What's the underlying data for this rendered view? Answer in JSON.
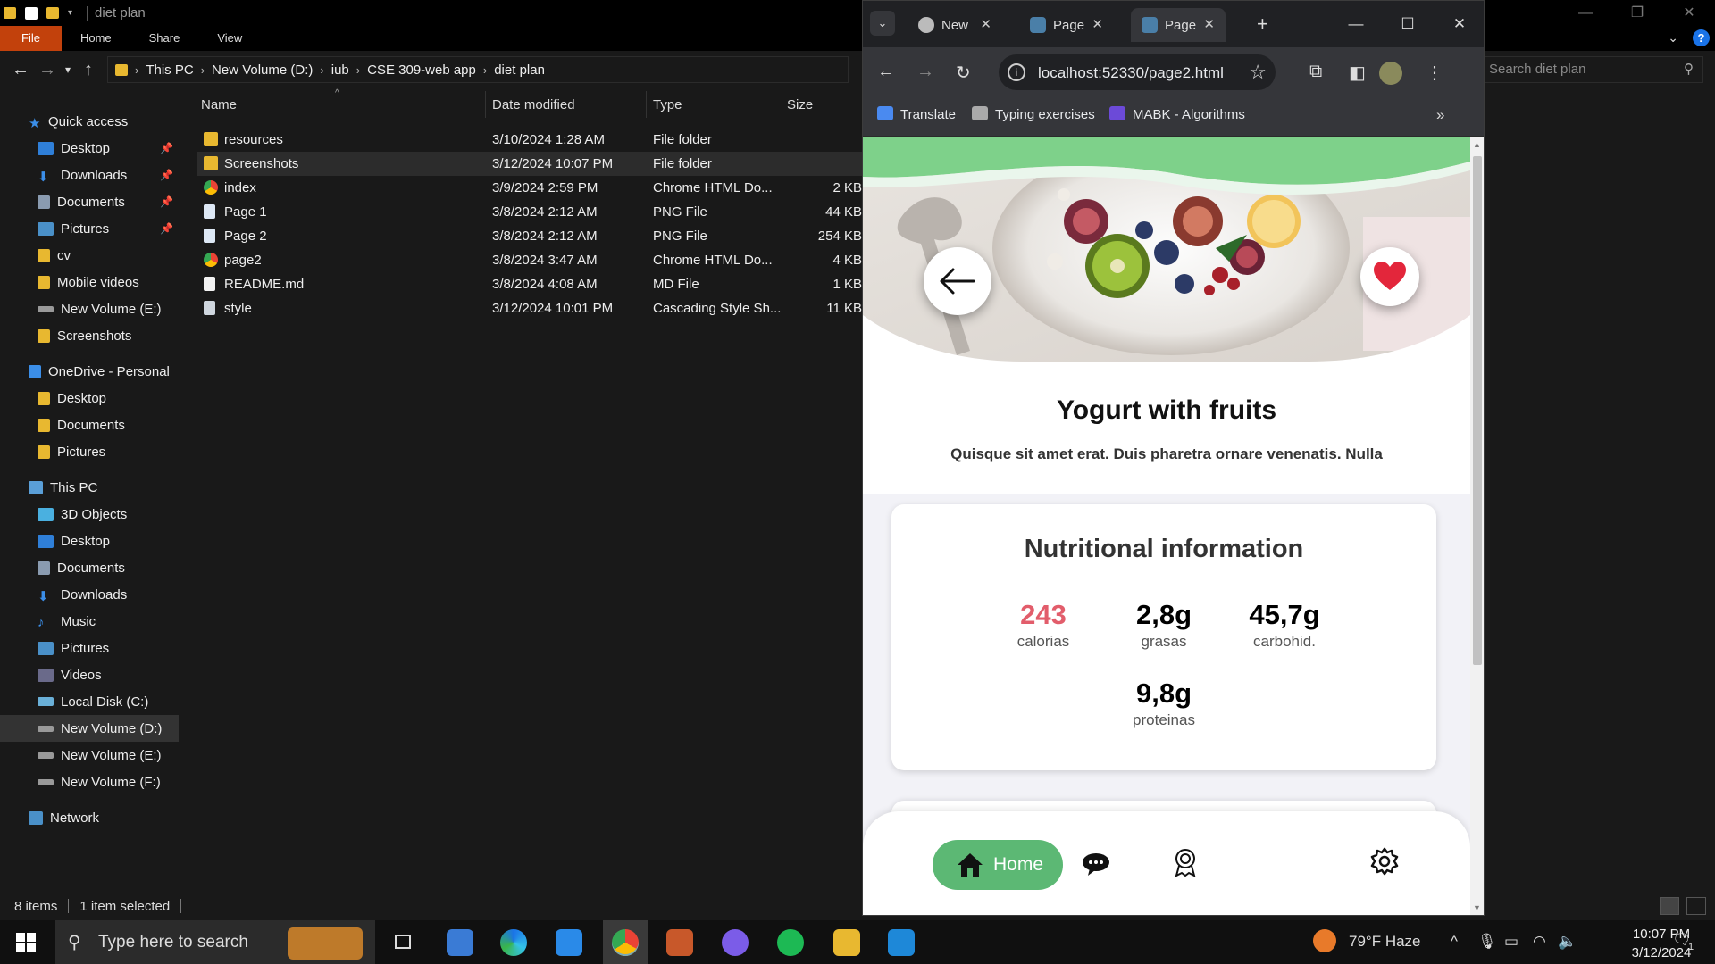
{
  "explorer": {
    "title": "diet plan",
    "ribbon_tabs": [
      "File",
      "Home",
      "Share",
      "View"
    ],
    "breadcrumb": [
      "This PC",
      "New Volume (D:)",
      "iub",
      "CSE 309-web app",
      "diet plan"
    ],
    "search_placeholder": "Search diet plan",
    "nav": {
      "quick_access": "Quick access",
      "quick_items": [
        "Desktop",
        "Downloads",
        "Documents",
        "Pictures",
        "cv",
        "Mobile videos",
        "New Volume (E:)",
        "Screenshots"
      ],
      "onedrive": "OneDrive - Personal",
      "onedrive_items": [
        "Desktop",
        "Documents",
        "Pictures"
      ],
      "this_pc": "This PC",
      "pc_items": [
        "3D Objects",
        "Desktop",
        "Documents",
        "Downloads",
        "Music",
        "Pictures",
        "Videos",
        "Local Disk (C:)",
        "New Volume (D:)",
        "New Volume (E:)",
        "New Volume (F:)"
      ],
      "network": "Network"
    },
    "columns": [
      "Name",
      "Date modified",
      "Type",
      "Size"
    ],
    "files": [
      {
        "name": "resources",
        "date": "3/10/2024 1:28 AM",
        "type": "File folder",
        "size": ""
      },
      {
        "name": "Screenshots",
        "date": "3/12/2024 10:07 PM",
        "type": "File folder",
        "size": ""
      },
      {
        "name": "index",
        "date": "3/9/2024 2:59 PM",
        "type": "Chrome HTML Do...",
        "size": "2 KB"
      },
      {
        "name": "Page 1",
        "date": "3/8/2024 2:12 AM",
        "type": "PNG File",
        "size": "44 KB"
      },
      {
        "name": "Page 2",
        "date": "3/8/2024 2:12 AM",
        "type": "PNG File",
        "size": "254 KB"
      },
      {
        "name": "page2",
        "date": "3/8/2024 3:47 AM",
        "type": "Chrome HTML Do...",
        "size": "4 KB"
      },
      {
        "name": "README.md",
        "date": "3/8/2024 4:08 AM",
        "type": "MD File",
        "size": "1 KB"
      },
      {
        "name": "style",
        "date": "3/12/2024 10:01 PM",
        "type": "Cascading Style Sh...",
        "size": "11 KB"
      }
    ],
    "status": {
      "items": "8 items",
      "selected": "1 item selected"
    }
  },
  "chrome": {
    "tabs": [
      {
        "title": "New"
      },
      {
        "title": "Page"
      },
      {
        "title": "Page"
      }
    ],
    "url": "localhost:52330/page2.html",
    "bookmarks": [
      "Translate",
      "Typing exercises",
      "MABK - Algorithms"
    ],
    "more_bookmarks": "»"
  },
  "page": {
    "dish_title": "Yogurt with fruits",
    "dish_desc": "Quisque sit amet erat. Duis pharetra ornare venenatis. Nulla",
    "nutrition_title": "Nutritional information",
    "stats": [
      {
        "value": "243",
        "label": "calorias"
      },
      {
        "value": "2,8g",
        "label": "grasas"
      },
      {
        "value": "45,7g",
        "label": "carbohid."
      },
      {
        "value": "9,8g",
        "label": "proteinas"
      }
    ],
    "nav_home": "Home",
    "accent_green": "#5cb874",
    "calorie_color": "#e25d6b"
  },
  "taskbar": {
    "search_placeholder": "Type here to search",
    "weather": "79°F  Haze",
    "time": "10:07 PM",
    "date": "3/12/2024",
    "notifications": "1"
  }
}
